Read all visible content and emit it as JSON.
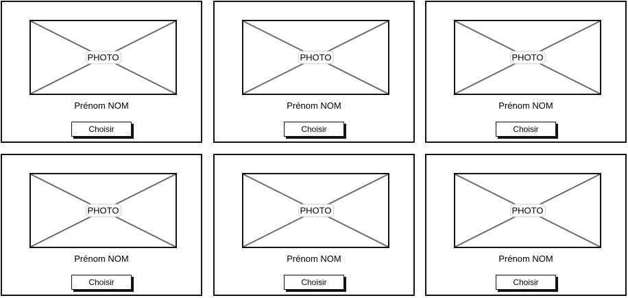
{
  "cards": [
    {
      "photo_label": "PHOTO",
      "name": "Prénom NOM",
      "button_label": "Choisir"
    },
    {
      "photo_label": "PHOTO",
      "name": "Prénom NOM",
      "button_label": "Choisir"
    },
    {
      "photo_label": "PHOTO",
      "name": "Prénom NOM",
      "button_label": "Choisir"
    },
    {
      "photo_label": "PHOTO",
      "name": "Prénom NOM",
      "button_label": "Choisir"
    },
    {
      "photo_label": "PHOTO",
      "name": "Prénom NOM",
      "button_label": "Choisir"
    },
    {
      "photo_label": "PHOTO",
      "name": "Prénom NOM",
      "button_label": "Choisir"
    }
  ],
  "icons": {
    "photo_placeholder": "image-placeholder-icon"
  },
  "colors": {
    "stroke": "#111111",
    "placeholder_cross": "#6b6b6b",
    "background": "#ffffff"
  }
}
